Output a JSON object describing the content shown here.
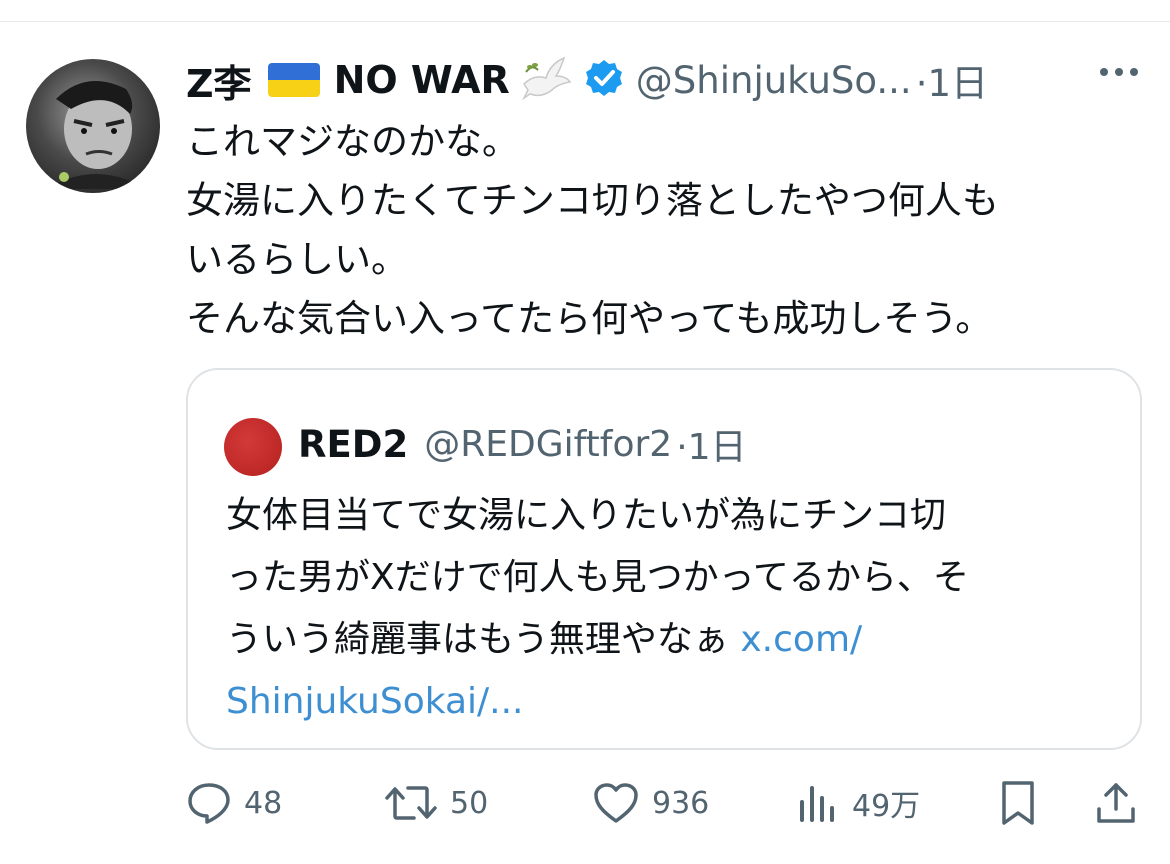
{
  "tweet": {
    "display_name": "Z李",
    "flag_icon": "ukraine-flag-icon",
    "display_suffix": "NO WAR",
    "dove_icon": "dove-icon",
    "verified_icon": "verified-badge-icon",
    "handle": "@ShinjukuSo...",
    "time": "·1日",
    "more_icon": "more-options-icon",
    "body_lines": [
      "これマジなのかな。",
      "女湯に入りたくてチンコ切り落としたやつ何人も",
      "いるらしい。",
      "そんな気合い入ってたら何やっても成功しそう。"
    ]
  },
  "quote": {
    "name": "RED2",
    "handle": "@REDGiftfor2",
    "time": "·1日",
    "body_lines": [
      "女体目当てで女湯に入りたいが為にチンコ切",
      "った男がXだけで何人も見つかってるから、そ",
      "ういう綺麗事はもう無理やなぁ "
    ],
    "link_part1": "x.com/",
    "link_part2": "ShinjukuSokai/..."
  },
  "actions": {
    "reply": {
      "icon": "reply-icon",
      "count": "48"
    },
    "retweet": {
      "icon": "retweet-icon",
      "count": "50"
    },
    "like": {
      "icon": "heart-icon",
      "count": "936"
    },
    "views": {
      "icon": "views-icon",
      "count": "49万"
    },
    "bookmark": {
      "icon": "bookmark-icon"
    },
    "share": {
      "icon": "share-icon"
    }
  },
  "colors": {
    "text": "#0f1419",
    "secondary": "#536471",
    "link": "#3d8fd1",
    "verified": "#1d9bf0",
    "border": "#dfe3e6"
  }
}
